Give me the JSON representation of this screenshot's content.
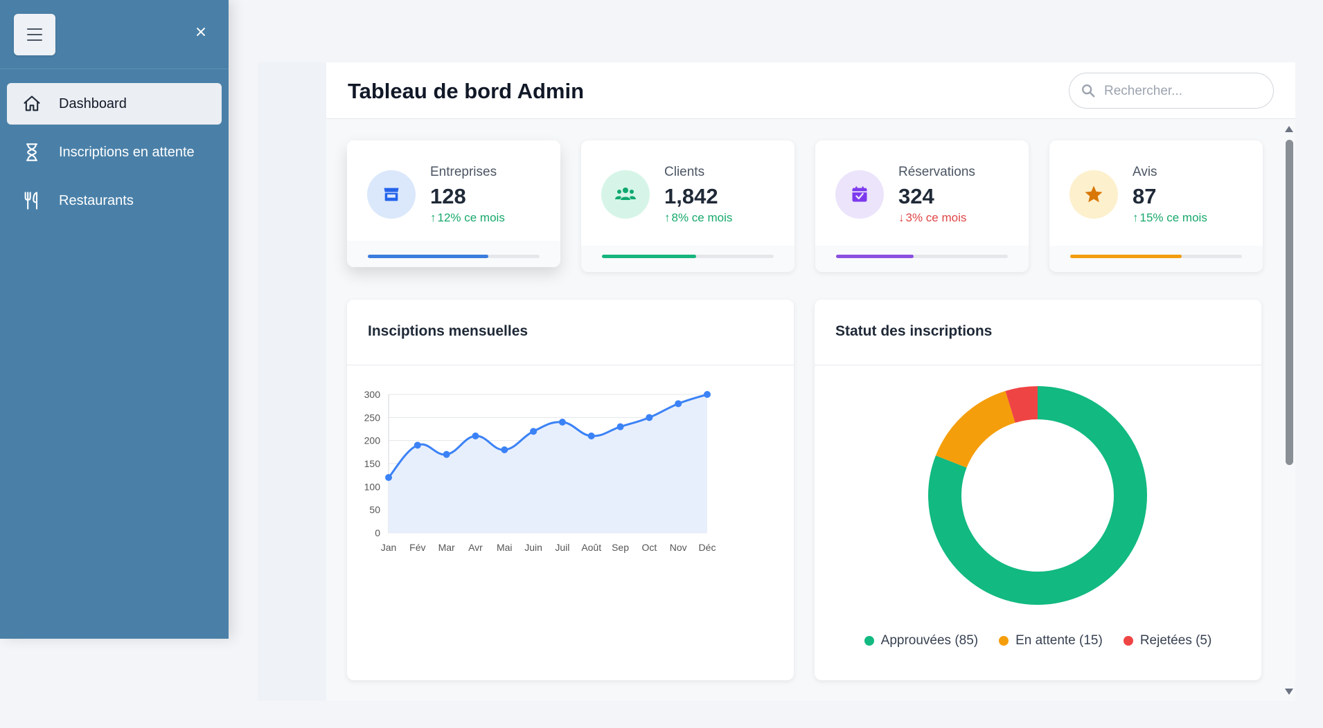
{
  "sidebar": {
    "items": [
      {
        "label": "Dashboard"
      },
      {
        "label": "Inscriptions en attente"
      },
      {
        "label": "Restaurants"
      }
    ]
  },
  "header": {
    "title": "Tableau de bord Admin",
    "search_placeholder": "Rechercher..."
  },
  "stats": [
    {
      "label": "Entreprises",
      "value": "128",
      "change": "12% ce mois",
      "trend": "up",
      "progress": 0.7,
      "color": "#3b7ddd",
      "icon": "store-icon",
      "icon_bg": "#dbe8fb"
    },
    {
      "label": "Clients",
      "value": "1,842",
      "change": "8% ce mois",
      "trend": "up",
      "progress": 0.55,
      "color": "#16b57e",
      "icon": "users-icon",
      "icon_bg": "#d6f5e8"
    },
    {
      "label": "Réservations",
      "value": "324",
      "change": "3% ce mois",
      "trend": "down",
      "progress": 0.45,
      "color": "#8b4fe0",
      "icon": "calendar-check-icon",
      "icon_bg": "#ece4fb"
    },
    {
      "label": "Avis",
      "value": "87",
      "change": "15% ce mois",
      "trend": "up",
      "progress": 0.65,
      "color": "#f29c0e",
      "icon": "star-icon",
      "icon_bg": "#fdf0cd"
    }
  ],
  "line_card": {
    "title": "Insciptions mensuelles"
  },
  "donut_card": {
    "title": "Statut des inscriptions"
  },
  "chart_data": [
    {
      "type": "line",
      "title": "Insciptions mensuelles",
      "categories": [
        "Jan",
        "Fév",
        "Mar",
        "Avr",
        "Mai",
        "Juin",
        "Juil",
        "Août",
        "Sep",
        "Oct",
        "Nov",
        "Déc"
      ],
      "values": [
        120,
        190,
        170,
        210,
        180,
        220,
        240,
        210,
        230,
        250,
        280,
        300
      ],
      "ylim": [
        0,
        300
      ],
      "yticks": [
        0,
        50,
        100,
        150,
        200,
        250,
        300
      ],
      "color": "#3b82f6",
      "fill": "#e8effc",
      "grid": true,
      "legend": "none"
    },
    {
      "type": "pie",
      "title": "Statut des inscriptions",
      "donut": true,
      "legend": "bottom",
      "slices": [
        {
          "label": "Approuvées (85)",
          "value": 85,
          "color": "#12b981"
        },
        {
          "label": "En attente (15)",
          "value": 15,
          "color": "#f59e0b"
        },
        {
          "label": "Rejetées (5)",
          "value": 5,
          "color": "#ef4444"
        }
      ]
    }
  ]
}
